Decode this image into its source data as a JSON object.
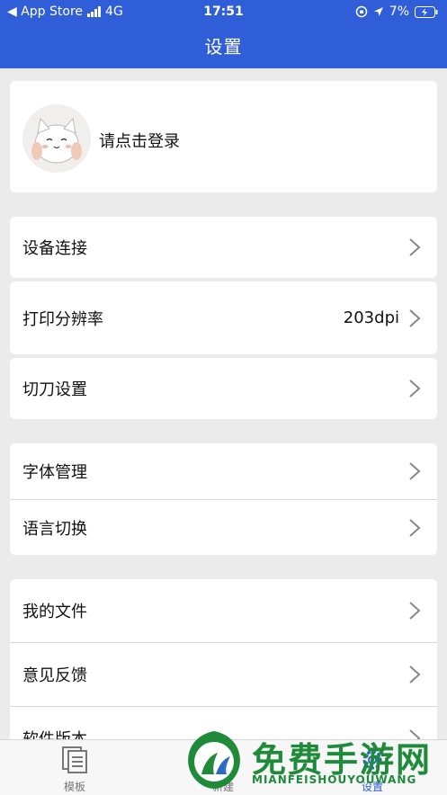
{
  "status_bar": {
    "back_label": "◀ App Store",
    "network": "4G",
    "time": "17:51",
    "battery": "7%"
  },
  "header": {
    "title": "设置"
  },
  "profile": {
    "login_prompt": "请点击登录"
  },
  "settings": {
    "device_connect": "设备连接",
    "print_resolution": "打印分辨率",
    "print_resolution_value": "203dpi",
    "cutter_settings": "切刀设置",
    "font_manage": "字体管理",
    "language_switch": "语言切换",
    "my_files": "我的文件",
    "feedback": "意见反馈",
    "software_version": "软件版本"
  },
  "tabbar": {
    "templates": "模板",
    "create": "新建",
    "settings": "设置"
  },
  "watermark": {
    "brand": "免费手游网",
    "domain": "MIANFEISHOUYOUWANG"
  },
  "colors": {
    "header_bg": "#2f5ed8",
    "page_bg": "#ebebeb",
    "watermark_green": "#1e8a3a"
  }
}
